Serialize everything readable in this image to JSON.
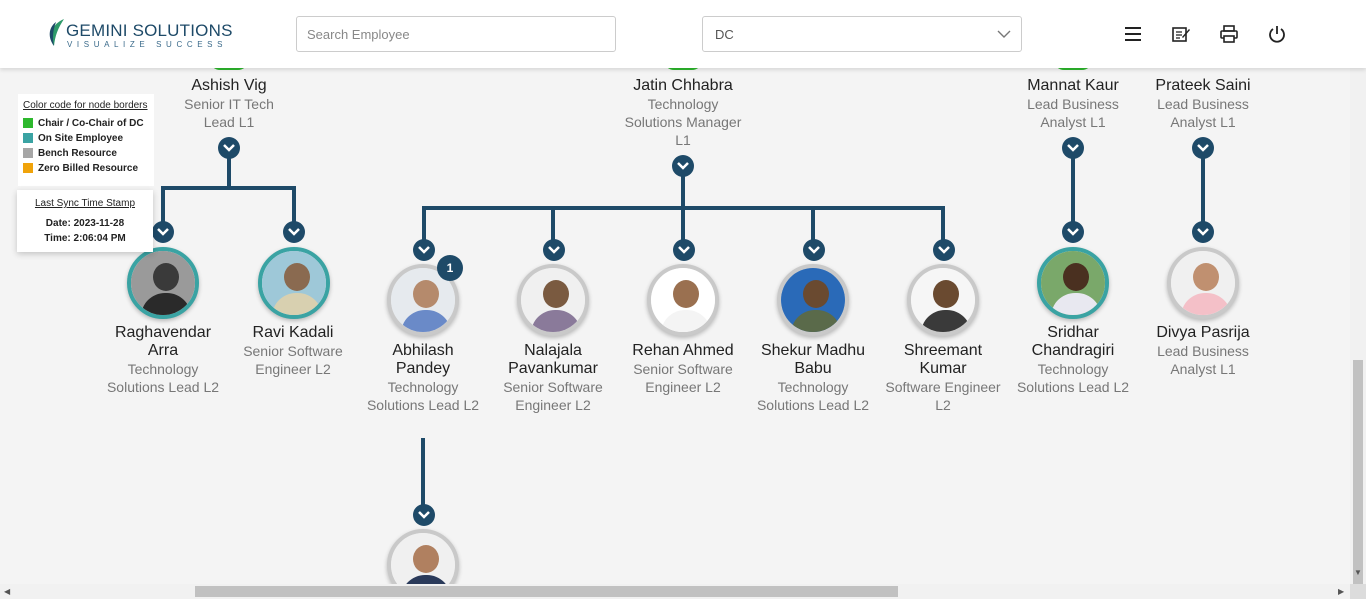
{
  "header": {
    "logo_brand": "GEMINI SOLUTIONS",
    "logo_tagline": "VISUALIZE SUCCESS",
    "search_placeholder": "Search Employee",
    "filter_value": "DC",
    "icons": [
      "menu-icon",
      "edit-note-icon",
      "print-icon",
      "power-icon"
    ]
  },
  "legend": {
    "title": "Color code for node borders",
    "items": [
      {
        "label": "Chair / Co-Chair of DC",
        "color": "#2db82d"
      },
      {
        "label": "On Site Employee",
        "color": "#3aa3a3"
      },
      {
        "label": "Bench Resource",
        "color": "#a6a6a6"
      },
      {
        "label": "Zero Billed Resource",
        "color": "#f0a30a"
      }
    ]
  },
  "sync": {
    "title": "Last Sync Time Stamp",
    "date": "Date: 2023-11-28",
    "time": "Time: 2:06:04 PM"
  },
  "colors": {
    "connector": "#1e4a68",
    "onsite": "#3aa3a3",
    "bench": "#c9c9c9"
  },
  "top_nodes": [
    {
      "name": "Ashish Vig",
      "title": "Senior IT Tech Lead L1"
    },
    {
      "name": "Jatin Chhabra",
      "title": "Technology Solutions Manager L1"
    },
    {
      "name": "Mannat Kaur",
      "title": "Lead Business Analyst L1"
    },
    {
      "name": "Prateek Saini",
      "title": "Lead Business Analyst L1"
    }
  ],
  "child_nodes": [
    {
      "name": "Raghavendar Arra",
      "title": "Technology Solutions Lead L2",
      "status": "onsite"
    },
    {
      "name": "Ravi Kadali",
      "title": "Senior Software Engineer L2",
      "status": "onsite"
    },
    {
      "name": "Abhilash Pandey",
      "title": "Technology Solutions Lead L2",
      "status": "bench",
      "badge": "1"
    },
    {
      "name": "Nalajala Pavankumar",
      "title": "Senior Software Engineer L2",
      "status": "bench"
    },
    {
      "name": "Rehan Ahmed",
      "title": "Senior Software Engineer L2",
      "status": "bench"
    },
    {
      "name": "Shekur Madhu Babu",
      "title": "Technology Solutions Lead L2",
      "status": "bench"
    },
    {
      "name": "Shreemant Kumar",
      "title": "Software Engineer L2",
      "status": "bench"
    },
    {
      "name": "Sridhar Chandragiri",
      "title": "Technology Solutions Lead L2",
      "status": "onsite"
    },
    {
      "name": "Divya Pasrija",
      "title": "Lead Business Analyst L1",
      "status": "bench"
    }
  ]
}
